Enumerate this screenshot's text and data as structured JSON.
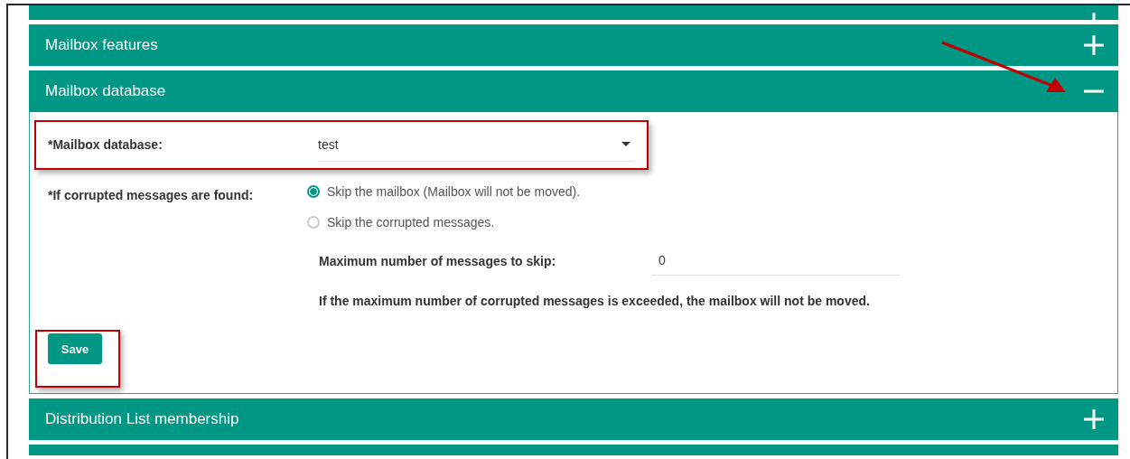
{
  "panels": [
    {
      "expanded": false
    },
    {
      "title": "Mailbox features",
      "expanded": false
    },
    {
      "title": "Mailbox database",
      "expanded": true,
      "database": {
        "label": "*Mailbox database:",
        "value": "test"
      },
      "corrupted": {
        "label": "*If corrupted messages are found:",
        "options": [
          {
            "label": "Skip the mailbox (Mailbox will not be moved).",
            "selected": true
          },
          {
            "label": "Skip the corrupted messages.",
            "selected": false
          }
        ]
      },
      "max_skip": {
        "label": "Maximum number of messages to skip:",
        "value": "0"
      },
      "note": "If the maximum number of corrupted messages is exceeded, the mailbox will not be moved.",
      "save_button": "Save"
    },
    {
      "title": "Distribution List membership",
      "expanded": false
    }
  ]
}
